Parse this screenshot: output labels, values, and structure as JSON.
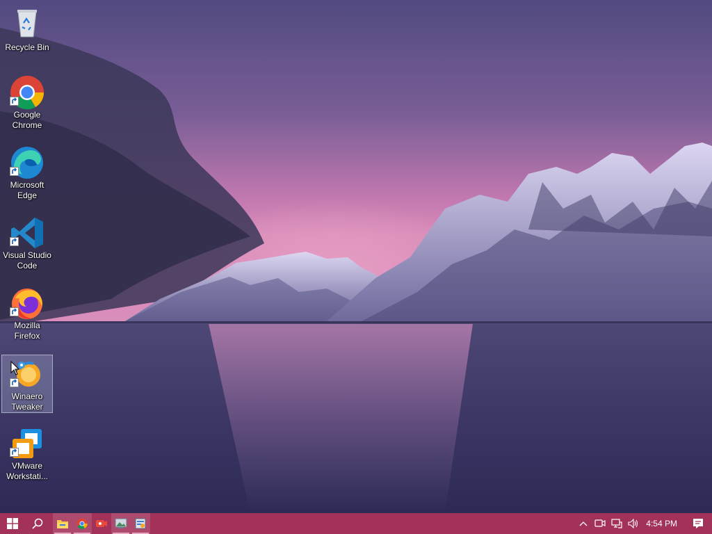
{
  "desktop": {
    "icons": [
      {
        "label": "Recycle Bin",
        "icon": "recycle-bin-icon",
        "shortcut": false
      },
      {
        "label": "Google\nChrome",
        "icon": "chrome-icon",
        "shortcut": true
      },
      {
        "label": "Microsoft\nEdge",
        "icon": "edge-icon",
        "shortcut": true
      },
      {
        "label": "Visual Studio\nCode",
        "icon": "vscode-icon",
        "shortcut": true
      },
      {
        "label": "Mozilla\nFirefox",
        "icon": "firefox-icon",
        "shortcut": true
      },
      {
        "label": "Winaero\nTweaker",
        "icon": "winaero-tweaker-icon",
        "shortcut": true,
        "selected": true
      },
      {
        "label": "VMware\nWorkstati...",
        "icon": "vmware-icon",
        "shortcut": true
      }
    ]
  },
  "taskbar": {
    "start": "windows-logo-icon",
    "search": "search-icon",
    "apps": [
      "file-explorer-icon",
      "chrome-icon",
      "video-recorder-icon",
      "picture-viewer-icon",
      "winaero-tweaker-icon"
    ],
    "tray": [
      "chevron-up-icon",
      "meet-now-icon",
      "network-icon",
      "volume-icon"
    ],
    "clock": "4:54 PM",
    "notifications": "action-center-icon",
    "color": "#a3325a"
  }
}
